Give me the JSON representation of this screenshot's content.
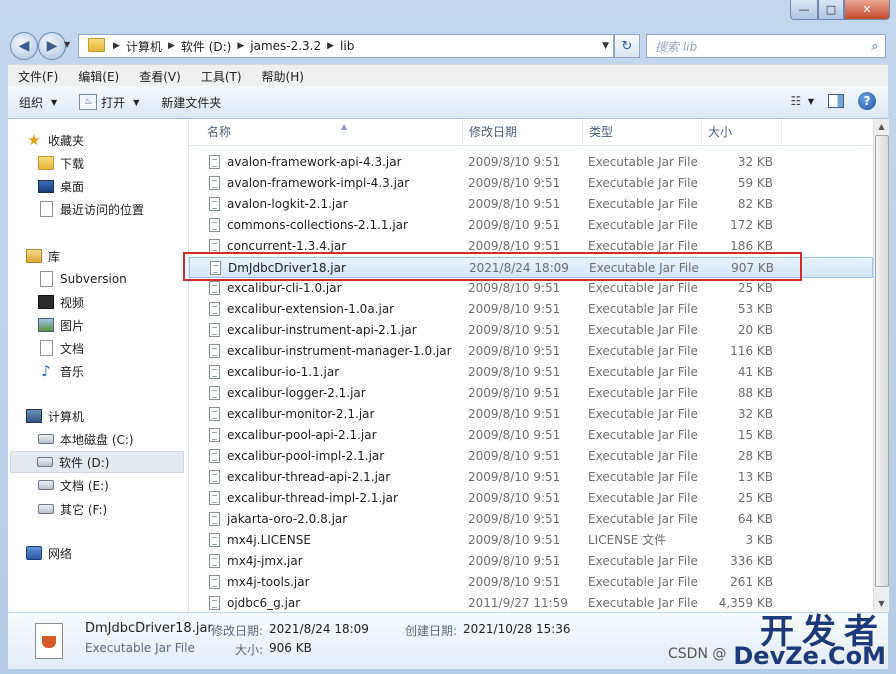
{
  "window": {
    "caption_min": "—",
    "caption_max": "□",
    "caption_close": "✕"
  },
  "address": {
    "segments": [
      "计算机",
      "软件 (D:)",
      "james-2.3.2",
      "lib"
    ],
    "search_placeholder": "搜索 lib"
  },
  "menu": [
    "文件(F)",
    "编辑(E)",
    "查看(V)",
    "工具(T)",
    "帮助(H)"
  ],
  "toolbar": {
    "organize": "组织",
    "open": "打开",
    "new_folder": "新建文件夹"
  },
  "nav": {
    "favorites": "收藏夹",
    "downloads": "下载",
    "desktop": "桌面",
    "recent": "最近访问的位置",
    "libraries": "库",
    "subversion": "Subversion",
    "videos": "视频",
    "pictures": "图片",
    "documents": "文档",
    "music": "音乐",
    "computer": "计算机",
    "drive_c": "本地磁盘 (C:)",
    "drive_d": "软件 (D:)",
    "drive_e": "文档 (E:)",
    "drive_f": "其它 (F:)",
    "network": "网络"
  },
  "columns": {
    "name": "名称",
    "date": "修改日期",
    "type": "类型",
    "size": "大小"
  },
  "files": [
    {
      "name": "avalon-framework-api-4.3.jar",
      "date": "2009/8/10 9:51",
      "type": "Executable Jar File",
      "size": "32 KB"
    },
    {
      "name": "avalon-framework-impl-4.3.jar",
      "date": "2009/8/10 9:51",
      "type": "Executable Jar File",
      "size": "59 KB"
    },
    {
      "name": "avalon-logkit-2.1.jar",
      "date": "2009/8/10 9:51",
      "type": "Executable Jar File",
      "size": "82 KB"
    },
    {
      "name": "commons-collections-2.1.1.jar",
      "date": "2009/8/10 9:51",
      "type": "Executable Jar File",
      "size": "172 KB"
    },
    {
      "name": "concurrent-1.3.4.jar",
      "date": "2009/8/10 9:51",
      "type": "Executable Jar File",
      "size": "186 KB"
    },
    {
      "name": "DmJdbcDriver18.jar",
      "date": "2021/8/24 18:09",
      "type": "Executable Jar File",
      "size": "907 KB"
    },
    {
      "name": "excalibur-cli-1.0.jar",
      "date": "2009/8/10 9:51",
      "type": "Executable Jar File",
      "size": "25 KB"
    },
    {
      "name": "excalibur-extension-1.0a.jar",
      "date": "2009/8/10 9:51",
      "type": "Executable Jar File",
      "size": "53 KB"
    },
    {
      "name": "excalibur-instrument-api-2.1.jar",
      "date": "2009/8/10 9:51",
      "type": "Executable Jar File",
      "size": "20 KB"
    },
    {
      "name": "excalibur-instrument-manager-1.0.jar",
      "date": "2009/8/10 9:51",
      "type": "Executable Jar File",
      "size": "116 KB"
    },
    {
      "name": "excalibur-io-1.1.jar",
      "date": "2009/8/10 9:51",
      "type": "Executable Jar File",
      "size": "41 KB"
    },
    {
      "name": "excalibur-logger-2.1.jar",
      "date": "2009/8/10 9:51",
      "type": "Executable Jar File",
      "size": "88 KB"
    },
    {
      "name": "excalibur-monitor-2.1.jar",
      "date": "2009/8/10 9:51",
      "type": "Executable Jar File",
      "size": "32 KB"
    },
    {
      "name": "excalibur-pool-api-2.1.jar",
      "date": "2009/8/10 9:51",
      "type": "Executable Jar File",
      "size": "15 KB"
    },
    {
      "name": "excalibur-pool-impl-2.1.jar",
      "date": "2009/8/10 9:51",
      "type": "Executable Jar File",
      "size": "28 KB"
    },
    {
      "name": "excalibur-thread-api-2.1.jar",
      "date": "2009/8/10 9:51",
      "type": "Executable Jar File",
      "size": "13 KB"
    },
    {
      "name": "excalibur-thread-impl-2.1.jar",
      "date": "2009/8/10 9:51",
      "type": "Executable Jar File",
      "size": "25 KB"
    },
    {
      "name": "jakarta-oro-2.0.8.jar",
      "date": "2009/8/10 9:51",
      "type": "Executable Jar File",
      "size": "64 KB"
    },
    {
      "name": "mx4j.LICENSE",
      "date": "2009/8/10 9:51",
      "type": "LICENSE 文件",
      "size": "3 KB"
    },
    {
      "name": "mx4j-jmx.jar",
      "date": "2009/8/10 9:51",
      "type": "Executable Jar File",
      "size": "336 KB"
    },
    {
      "name": "mx4j-tools.jar",
      "date": "2009/8/10 9:51",
      "type": "Executable Jar File",
      "size": "261 KB"
    },
    {
      "name": "ojdbc6_g.jar",
      "date": "2011/9/27 11:59",
      "type": "Executable Jar File",
      "size": "4,359 KB"
    }
  ],
  "selected_index": 5,
  "details": {
    "name": "DmJdbcDriver18.jar",
    "type": "Executable Jar File",
    "modified_label": "修改日期:",
    "modified": "2021/8/24 18:09",
    "created_label": "创建日期:",
    "created": "2021/10/28 15:36",
    "size_label": "大小:",
    "size": "906 KB"
  },
  "watermark": {
    "line1": "开发者",
    "line2": "DevZe.CoM",
    "csdn": "CSDN @"
  }
}
